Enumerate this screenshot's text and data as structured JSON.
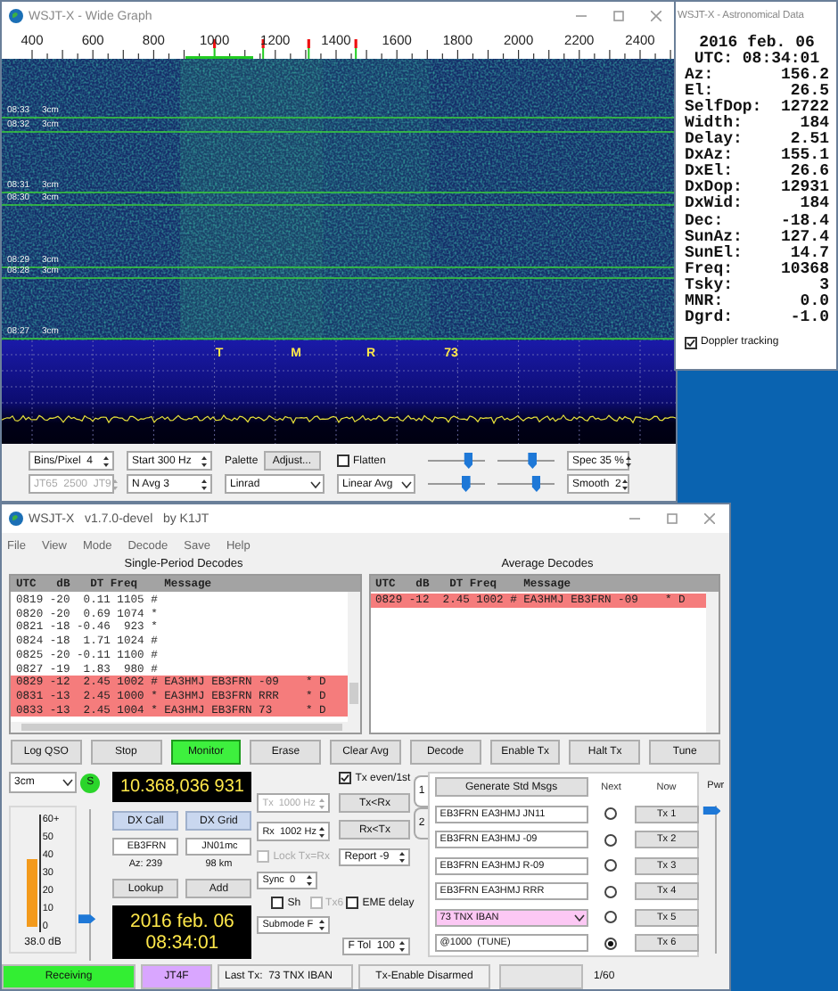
{
  "wide_graph": {
    "title": "WSJT-X - Wide Graph",
    "freq_labels": [
      "400",
      "600",
      "800",
      "1000",
      "1200",
      "1400",
      "1600",
      "1800",
      "2000",
      "2200",
      "2400"
    ],
    "time_marks": [
      {
        "time": "08:33",
        "band": "3cm"
      },
      {
        "time": "08:32",
        "band": "3cm"
      },
      {
        "time": "08:31",
        "band": "3cm"
      },
      {
        "time": "08:30",
        "band": "3cm"
      },
      {
        "time": "08:29",
        "band": "3cm"
      },
      {
        "time": "08:28",
        "band": "3cm"
      },
      {
        "time": "08:27",
        "band": "3cm"
      }
    ],
    "tone_labels": [
      "T",
      "M",
      "R",
      "73"
    ],
    "bins_per_pixel": "Bins/Pixel  4",
    "start": "Start 300 Hz",
    "palette_label": "Palette",
    "adjust_button": "Adjust...",
    "flatten": {
      "label": "Flatten",
      "checked": false
    },
    "spec": "Spec 35 %",
    "mode_range": "JT65  2500  JT9",
    "n_avg": "N Avg 3",
    "palette": "Linrad",
    "avg_mode": "Linear Avg",
    "smooth": "Smooth  2",
    "sliders": [
      {
        "level": 0.7
      },
      {
        "level": 0.6
      },
      {
        "level": 0.65
      },
      {
        "level": 0.67
      }
    ]
  },
  "astro": {
    "title": "WSJT-X - Astronomical Data",
    "date": "2016 feb. 06",
    "utc": "UTC: 08:34:01",
    "rows": [
      {
        "label": "Az:",
        "value": "156.2"
      },
      {
        "label": "El:",
        "value": "26.5"
      },
      {
        "label": "SelfDop:",
        "value": "12722"
      },
      {
        "label": "Width:",
        "value": "184"
      },
      {
        "label": "Delay:",
        "value": "2.51"
      },
      {
        "label": "DxAz:",
        "value": "155.1"
      },
      {
        "label": "DxEl:",
        "value": "26.6"
      },
      {
        "label": "DxDop:",
        "value": "12931"
      },
      {
        "label": "DxWid:",
        "value": "184"
      },
      {
        "label": "Dec:",
        "value": "-18.4"
      },
      {
        "label": "SunAz:",
        "value": "127.4"
      },
      {
        "label": "SunEl:",
        "value": "14.7"
      },
      {
        "label": "Freq:",
        "value": "10368"
      },
      {
        "label": "Tsky:",
        "value": "3"
      },
      {
        "label": "MNR:",
        "value": "0.0"
      },
      {
        "label": "Dgrd:",
        "value": "-1.0"
      }
    ],
    "doppler": {
      "label": "Doppler tracking",
      "checked": true
    }
  },
  "main": {
    "title": "WSJT-X   v1.7.0-devel   by K1JT",
    "menu": [
      "File",
      "View",
      "Mode",
      "Decode",
      "Save",
      "Help"
    ],
    "single": {
      "heading": "Single-Period Decodes",
      "header": "UTC   dB   DT Freq    Message",
      "rows": [
        {
          "text": "0819 -20  0.11 1105 #",
          "highlighted": false
        },
        {
          "text": "0820 -20  0.69 1074 *",
          "highlighted": false
        },
        {
          "text": "0821 -18 -0.46  923 *",
          "highlighted": false
        },
        {
          "text": "0824 -18  1.71 1024 #",
          "highlighted": false
        },
        {
          "text": "0825 -20 -0.11 1100 #",
          "highlighted": false
        },
        {
          "text": "0827 -19  1.83  980 #",
          "highlighted": false
        },
        {
          "text": "0829 -12  2.45 1002 # EA3HMJ EB3FRN -09    * D",
          "highlighted": true
        },
        {
          "text": "0831 -13  2.45 1000 * EA3HMJ EB3FRN RRR    * D",
          "highlighted": true
        },
        {
          "text": "0833 -13  2.45 1004 * EA3HMJ EB3FRN 73     * D",
          "highlighted": true
        }
      ]
    },
    "average": {
      "heading": "Average Decodes",
      "header": "UTC   dB   DT Freq    Message",
      "rows": [
        {
          "text": "0829 -12  2.45 1002 # EA3HMJ EB3FRN -09    * D",
          "highlighted": true
        }
      ]
    },
    "buttons": [
      {
        "label": "Log QSO",
        "on": false
      },
      {
        "label": "Stop",
        "on": false
      },
      {
        "label": "Monitor",
        "on": true
      },
      {
        "label": "Erase",
        "on": false
      },
      {
        "label": "Clear Avg",
        "on": false
      },
      {
        "label": "Decode",
        "on": false
      },
      {
        "label": "Enable Tx",
        "on": false
      },
      {
        "label": "Halt Tx",
        "on": false
      },
      {
        "label": "Tune",
        "on": false
      }
    ],
    "band": "3cm",
    "s_badge": "S",
    "frequency": "10.368,036 931",
    "meter": {
      "ticks": [
        "60+",
        "50",
        "40",
        "30",
        "20",
        "10",
        "0"
      ],
      "level": 0.64,
      "reading": "38.0 dB"
    },
    "rx_slider": {
      "level": 0.28
    },
    "dx_call_button": "DX Call",
    "dx_grid_button": "DX Grid",
    "dx_call": "EB3FRN",
    "dx_grid": "JN01mc",
    "azimuth": "Az: 239",
    "distance": "98 km",
    "lookup_button": "Lookup",
    "add_button": "Add",
    "clock_date": "2016 feb. 06",
    "clock_time": "08:34:01",
    "tx_freq": {
      "label": "Tx  1000 Hz",
      "disabled": true
    },
    "rx_freq": {
      "label": "Rx  1002 Hz",
      "disabled": false
    },
    "lock": {
      "label": "Lock Tx=Rx",
      "checked": false,
      "disabled": true
    },
    "sync": "Sync  0",
    "sh": {
      "label": "Sh",
      "checked": false,
      "disabled": false
    },
    "tx6": {
      "label": "Tx6",
      "checked": false,
      "disabled": true
    },
    "submode": "Submode F",
    "tx_even": {
      "label": "Tx even/1st",
      "checked": true,
      "disabled": false
    },
    "tx_lt_rx": "Tx<Rx",
    "rx_lt_tx": "Rx<Tx",
    "report": "Report -9",
    "eme_delay": {
      "label": "EME delay",
      "checked": false,
      "disabled": false
    },
    "ftol": "F Tol  100",
    "tabs": [
      {
        "label": "1",
        "selected": true
      },
      {
        "label": "2",
        "selected": false
      }
    ],
    "generate_button": "Generate Std Msgs",
    "next_label": "Next",
    "now_label": "Now",
    "messages": [
      {
        "text": "EB3FRN EA3HMJ JN11",
        "kind": "field",
        "highlighted": false,
        "selected": false,
        "button": "Tx 1"
      },
      {
        "text": "EB3FRN EA3HMJ -09",
        "kind": "field",
        "highlighted": false,
        "selected": false,
        "button": "Tx 2"
      },
      {
        "text": "EB3FRN EA3HMJ R-09",
        "kind": "field",
        "highlighted": false,
        "selected": false,
        "button": "Tx 3"
      },
      {
        "text": "EB3FRN EA3HMJ RRR",
        "kind": "field",
        "highlighted": false,
        "selected": false,
        "button": "Tx 4"
      },
      {
        "text": "73 TNX IBAN",
        "kind": "combo",
        "highlighted": true,
        "selected": false,
        "button": "Tx 5"
      },
      {
        "text": "@1000  (TUNE)",
        "kind": "field",
        "highlighted": false,
        "selected": true,
        "button": "Tx 6"
      }
    ],
    "pwr": {
      "label": "Pwr",
      "level": 0.97
    },
    "status": [
      {
        "kind": "badge",
        "text": "Receiving",
        "color": "#33ee33"
      },
      {
        "kind": "badge",
        "text": "JT4F",
        "color": "#d9a6ff"
      },
      {
        "kind": "text",
        "text": "Last Tx:  73 TNX IBAN"
      },
      {
        "kind": "text",
        "text": "Tx-Enable Disarmed"
      },
      {
        "kind": "progress",
        "level": 0
      },
      {
        "kind": "plain",
        "text": "1/60"
      }
    ]
  }
}
